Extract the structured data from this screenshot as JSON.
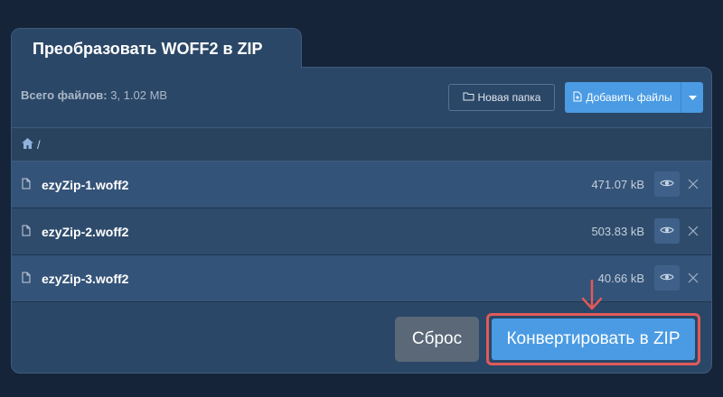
{
  "tab_title": "Преобразовать WOFF2 в ZIP",
  "summary": {
    "label": "Всего файлов:",
    "value": "3, 1.02 MB"
  },
  "toolbar": {
    "new_folder_label": "Новая папка",
    "add_files_label": "Добавить файлы"
  },
  "breadcrumb": {
    "path": "/"
  },
  "files": [
    {
      "name": "ezyZip-1.woff2",
      "size": "471.07 kB"
    },
    {
      "name": "ezyZip-2.woff2",
      "size": "503.83 kB"
    },
    {
      "name": "ezyZip-3.woff2",
      "size": "40.66 kB"
    }
  ],
  "actions": {
    "reset_label": "Сброс",
    "convert_label": "Конвертировать в ZIP"
  },
  "colors": {
    "background": "#152438",
    "panel": "#2b4767",
    "accent": "#4a9be3",
    "highlight": "#e05a5a",
    "reset": "#5a6878"
  }
}
